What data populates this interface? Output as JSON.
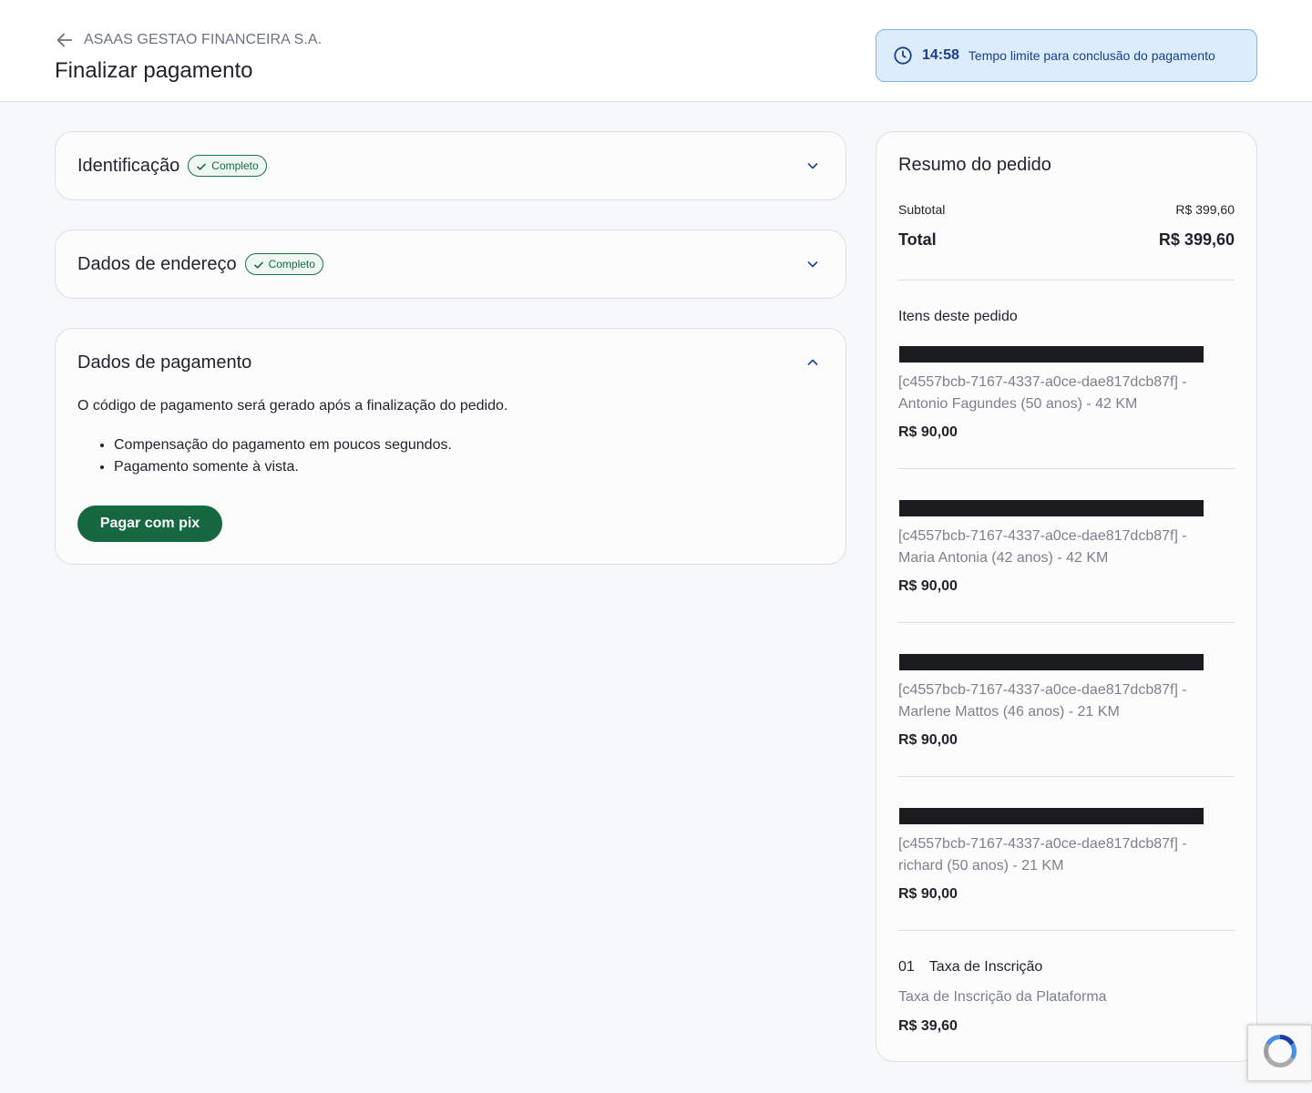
{
  "header": {
    "merchant": "ASAAS GESTAO FINANCEIRA S.A.",
    "title": "Finalizar pagamento",
    "timer_value": "14:58",
    "timer_text": "Tempo limite para conclusão do pagamento"
  },
  "sections": {
    "identification": {
      "title": "Identificação",
      "badge": "Completo"
    },
    "address": {
      "title": "Dados de endereço",
      "badge": "Completo"
    },
    "payment": {
      "title": "Dados de pagamento",
      "description": "O código de pagamento será gerado após a finalização do pedido.",
      "bullets": [
        "Compensação do pagamento em poucos segundos.",
        "Pagamento somente à vista."
      ],
      "button_label": "Pagar com pix"
    }
  },
  "summary": {
    "title": "Resumo do pedido",
    "subtotal_label": "Subtotal",
    "subtotal_value": "R$ 399,60",
    "total_label": "Total",
    "total_value": "R$ 399,60",
    "items_heading": "Itens deste pedido",
    "items": [
      {
        "description": "[c4557bcb-7167-4337-a0ce-dae817dcb87f] - Antonio Fagundes (50 anos) - 42 KM",
        "price": "R$ 90,00"
      },
      {
        "description": "[c4557bcb-7167-4337-a0ce-dae817dcb87f] - Maria Antonia (42 anos) - 42 KM",
        "price": "R$ 90,00"
      },
      {
        "description": "[c4557bcb-7167-4337-a0ce-dae817dcb87f] - Marlene Mattos (46 anos) - 21 KM",
        "price": "R$ 90,00"
      },
      {
        "description": "[c4557bcb-7167-4337-a0ce-dae817dcb87f] - richard (50 anos) - 21 KM",
        "price": "R$ 90,00"
      }
    ],
    "fee": {
      "quantity": "01",
      "title": "Taxa de Inscrição",
      "description": "Taxa de Inscrição da Plataforma",
      "price": "R$ 39,60"
    }
  },
  "colors": {
    "accent_green": "#166841",
    "timer_background": "#dcecfd",
    "link_blue": "#1a3f8f"
  },
  "icons": {
    "back": "arrow-left-icon",
    "timer": "clock-icon",
    "badge": "check-icon",
    "collapsed": "chevron-down-icon",
    "expanded": "chevron-up-icon",
    "captcha": "recaptcha-icon"
  }
}
